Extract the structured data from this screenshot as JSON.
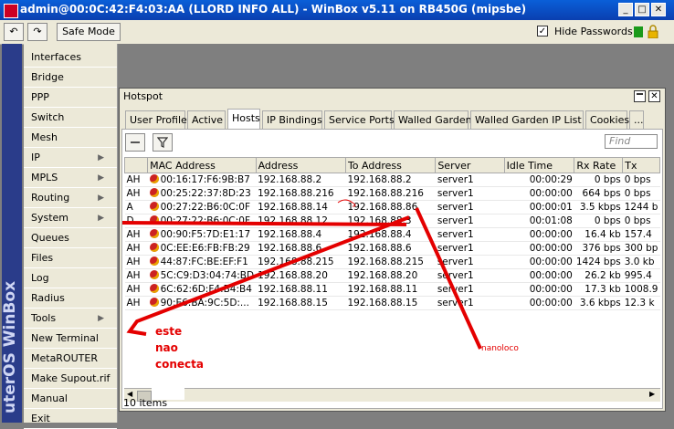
{
  "window": {
    "title": "admin@00:0C:42:F4:03:AA (LLORD INFO ALL) - WinBox v5.11 on RB450G (mipsbe)",
    "minimize": "_",
    "maximize": "□",
    "close": "✕"
  },
  "toolbar": {
    "undo": "↶",
    "redo": "↷",
    "safe_mode": "Safe Mode",
    "hide_passwords": "Hide Passwords",
    "hide_passwords_checked": true
  },
  "sidebar": {
    "brand": "uterOS WinBox",
    "items": [
      {
        "label": "Interfaces",
        "submenu": false
      },
      {
        "label": "Bridge",
        "submenu": false
      },
      {
        "label": "PPP",
        "submenu": false
      },
      {
        "label": "Switch",
        "submenu": false
      },
      {
        "label": "Mesh",
        "submenu": false
      },
      {
        "label": "IP",
        "submenu": true
      },
      {
        "label": "MPLS",
        "submenu": true
      },
      {
        "label": "Routing",
        "submenu": true
      },
      {
        "label": "System",
        "submenu": true
      },
      {
        "label": "Queues",
        "submenu": false
      },
      {
        "label": "Files",
        "submenu": false
      },
      {
        "label": "Log",
        "submenu": false
      },
      {
        "label": "Radius",
        "submenu": false
      },
      {
        "label": "Tools",
        "submenu": true
      },
      {
        "label": "New Terminal",
        "submenu": false
      },
      {
        "label": "MetaROUTER",
        "submenu": false
      },
      {
        "label": "Make Supout.rif",
        "submenu": false
      },
      {
        "label": "Manual",
        "submenu": false
      },
      {
        "label": "Exit",
        "submenu": false
      }
    ]
  },
  "hotspot": {
    "title": "Hotspot",
    "tabs": [
      "User Profiles",
      "Active",
      "Hosts",
      "IP Bindings",
      "Service Ports",
      "Walled Garden",
      "Walled Garden IP List",
      "Cookies",
      "..."
    ],
    "active_tab": "Hosts",
    "find_placeholder": "Find",
    "columns": [
      "",
      "MAC Address",
      "Address",
      "To Address",
      "Server",
      "Idle Time",
      "Rx Rate",
      "Tx"
    ],
    "rows": [
      {
        "flag": "AH",
        "mac": "00:16:17:F6:9B:B7",
        "address": "192.168.88.2",
        "to": "192.168.88.2",
        "server": "server1",
        "idle": "00:00:29",
        "rx": "0 bps",
        "tx": "0 bps"
      },
      {
        "flag": "AH",
        "mac": "00:25:22:37:8D:23",
        "address": "192.168.88.216",
        "to": "192.168.88.216",
        "server": "server1",
        "idle": "00:00:00",
        "rx": "664 bps",
        "tx": "0 bps"
      },
      {
        "flag": "A",
        "mac": "00:27:22:B6:0C:0F",
        "address": "192.168.88.14",
        "to": "192.168.88.86",
        "server": "server1",
        "idle": "00:00:01",
        "rx": "3.5 kbps",
        "tx": "1244 b"
      },
      {
        "flag": "D",
        "mac": "00:27:22:B6:0C:0F",
        "address": "192.168.88.12",
        "to": "192.168.88.3",
        "server": "server1",
        "idle": "00:01:08",
        "rx": "0 bps",
        "tx": "0 bps"
      },
      {
        "flag": "AH",
        "mac": "00:90:F5:7D:E1:17",
        "address": "192.168.88.4",
        "to": "192.168.88.4",
        "server": "server1",
        "idle": "00:00:00",
        "rx": "16.4 kb",
        "tx": "157.4"
      },
      {
        "flag": "AH",
        "mac": "0C:EE:E6:FB:FB:29",
        "address": "192.168.88.6",
        "to": "192.168.88.6",
        "server": "server1",
        "idle": "00:00:00",
        "rx": "376 bps",
        "tx": "300 bp"
      },
      {
        "flag": "AH",
        "mac": "44:87:FC:BE:EF:F1",
        "address": "192.168.88.215",
        "to": "192.168.88.215",
        "server": "server1",
        "idle": "00:00:00",
        "rx": "1424 bps",
        "tx": "3.0 kb"
      },
      {
        "flag": "AH",
        "mac": "5C:C9:D3:04:74:BD",
        "address": "192.168.88.20",
        "to": "192.168.88.20",
        "server": "server1",
        "idle": "00:00:00",
        "rx": "26.2 kb",
        "tx": "995.4"
      },
      {
        "flag": "AH",
        "mac": "6C:62:6D:F4:B4:B4",
        "address": "192.168.88.11",
        "to": "192.168.88.11",
        "server": "server1",
        "idle": "00:00:00",
        "rx": "17.3 kb",
        "tx": "1008.9"
      },
      {
        "flag": "AH",
        "mac": "90:E6:BA:9C:5D:...",
        "address": "192.168.88.15",
        "to": "192.168.88.15",
        "server": "server1",
        "idle": "00:00:00",
        "rx": "3.6 kbps",
        "tx": "12.3 k"
      }
    ],
    "status": "10 items"
  },
  "annotations": {
    "note_left": [
      "este",
      "nao",
      "conecta"
    ],
    "note_right": "nanoloco",
    "color": "#e40000"
  }
}
